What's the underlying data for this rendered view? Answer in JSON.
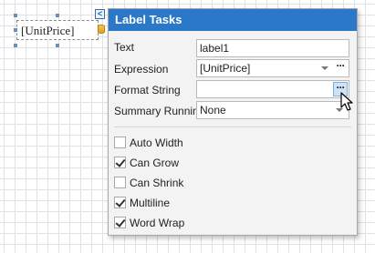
{
  "design_surface": {
    "label_text": "[UnitPrice]",
    "tasks_toggle_glyph": "<"
  },
  "panel": {
    "title": "Label Tasks",
    "fields": [
      {
        "label": "Text",
        "value": "label1"
      },
      {
        "label": "Expression",
        "value": "[UnitPrice]"
      },
      {
        "label": "Format String",
        "value": ""
      },
      {
        "label": "Summary Running",
        "value": "None"
      }
    ],
    "ellipsis_glyph": "···",
    "checkboxes": [
      {
        "label": "Auto Width",
        "checked": false
      },
      {
        "label": "Can Grow",
        "checked": true
      },
      {
        "label": "Can Shrink",
        "checked": false
      },
      {
        "label": "Multiline",
        "checked": true
      },
      {
        "label": "Word Wrap",
        "checked": true
      }
    ]
  },
  "colors": {
    "header_bg": "#2b78c8",
    "panel_bg": "#f3f3f3",
    "hover_button": "#cfe3f7"
  }
}
